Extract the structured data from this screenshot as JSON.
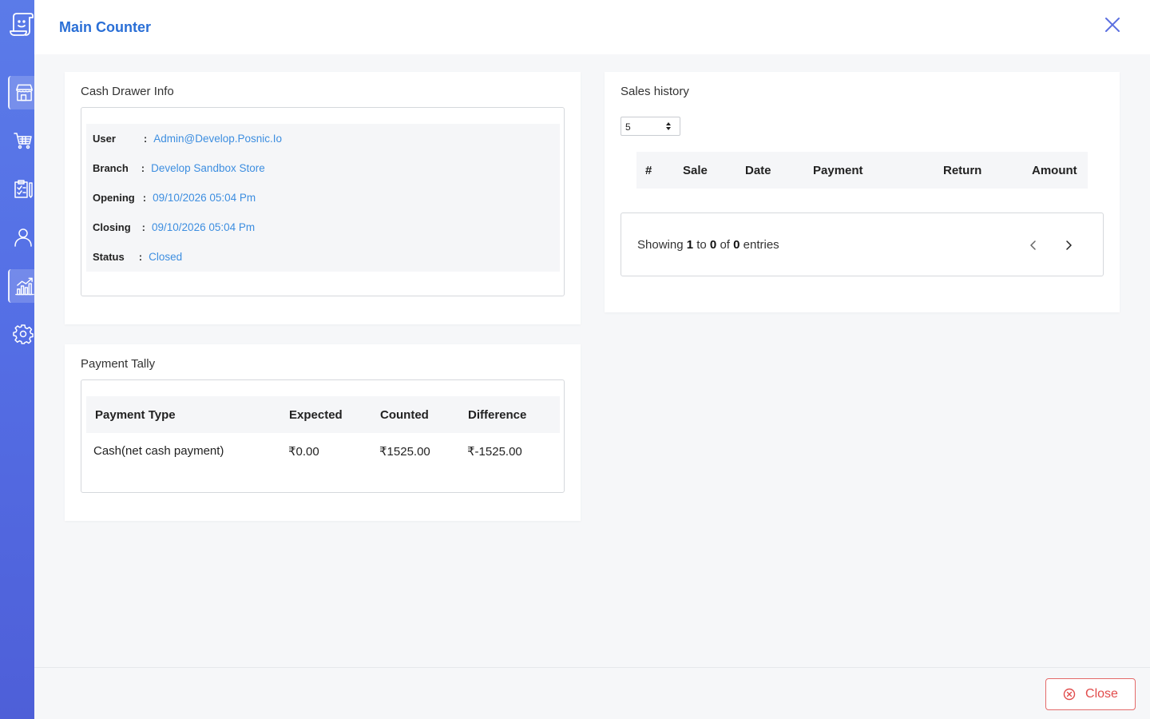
{
  "window": {
    "title": "Main Counter"
  },
  "sidebar": {
    "logo_icon": "receipt-smile-icon",
    "items": [
      {
        "icon": "store-icon",
        "active": true
      },
      {
        "icon": "cart-icon",
        "active": false
      },
      {
        "icon": "clipboard-icon",
        "active": false
      },
      {
        "icon": "user-icon",
        "active": false
      },
      {
        "icon": "chart-icon",
        "active": true
      },
      {
        "icon": "gear-icon",
        "active": false
      }
    ]
  },
  "cash_drawer": {
    "title": "Cash Drawer Info",
    "rows": [
      {
        "label": "User",
        "value": "Admin@Develop.Posnic.Io"
      },
      {
        "label": "Branch",
        "value": "Develop Sandbox Store"
      },
      {
        "label": "Opening",
        "value": "09/10/2026 05:04 Pm"
      },
      {
        "label": "Closing",
        "value": "09/10/2026 05:04 Pm"
      },
      {
        "label": "Status",
        "value": "Closed"
      }
    ],
    "separator": ":"
  },
  "payment_tally": {
    "title": "Payment Tally",
    "headers": [
      "Payment Type",
      "Expected",
      "Counted",
      "Difference"
    ],
    "rows": [
      [
        "Cash(net cash payment)",
        "₹0.00",
        "₹1525.00",
        "₹-1525.00"
      ]
    ]
  },
  "sales_history": {
    "title": "Sales history",
    "page_size": "5",
    "headers": [
      "#",
      "Sale",
      "Date",
      "Payment",
      "Return",
      "Amount"
    ],
    "showing": {
      "prefix": "Showing",
      "from": "1",
      "to_word": "to",
      "to": "0",
      "of_word": "of",
      "total": "0",
      "suffix": "entries"
    }
  },
  "footer": {
    "close_label": "Close"
  },
  "colors": {
    "accent": "#2a6fd6",
    "link": "#3d8ee0",
    "danger": "#e14c4c",
    "sidebar": "#5570e6"
  }
}
